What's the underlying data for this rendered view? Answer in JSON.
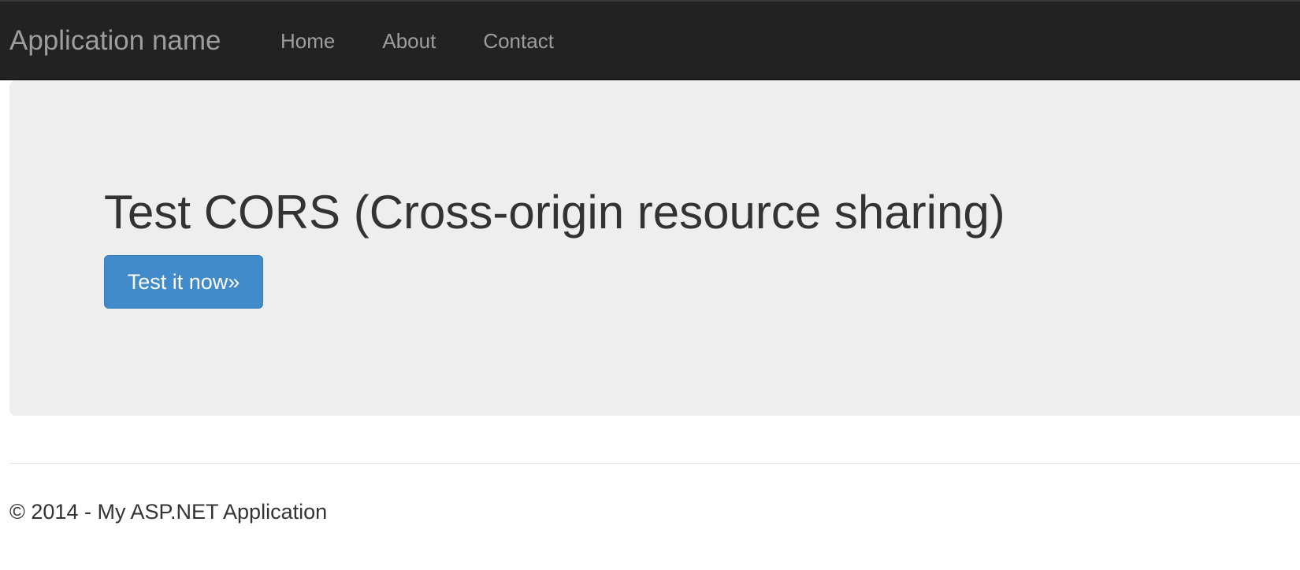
{
  "navbar": {
    "brand": "Application name",
    "links": [
      {
        "label": "Home"
      },
      {
        "label": "About"
      },
      {
        "label": "Contact"
      }
    ]
  },
  "jumbotron": {
    "title": "Test CORS (Cross-origin resource sharing)",
    "button_label": "Test it now»"
  },
  "footer": {
    "text": "© 2014 - My ASP.NET Application"
  },
  "colors": {
    "navbar_bg": "#222222",
    "nav_text": "#9d9d9d",
    "jumbotron_bg": "#eeeeee",
    "primary_button": "#428bca",
    "body_text": "#333333"
  }
}
